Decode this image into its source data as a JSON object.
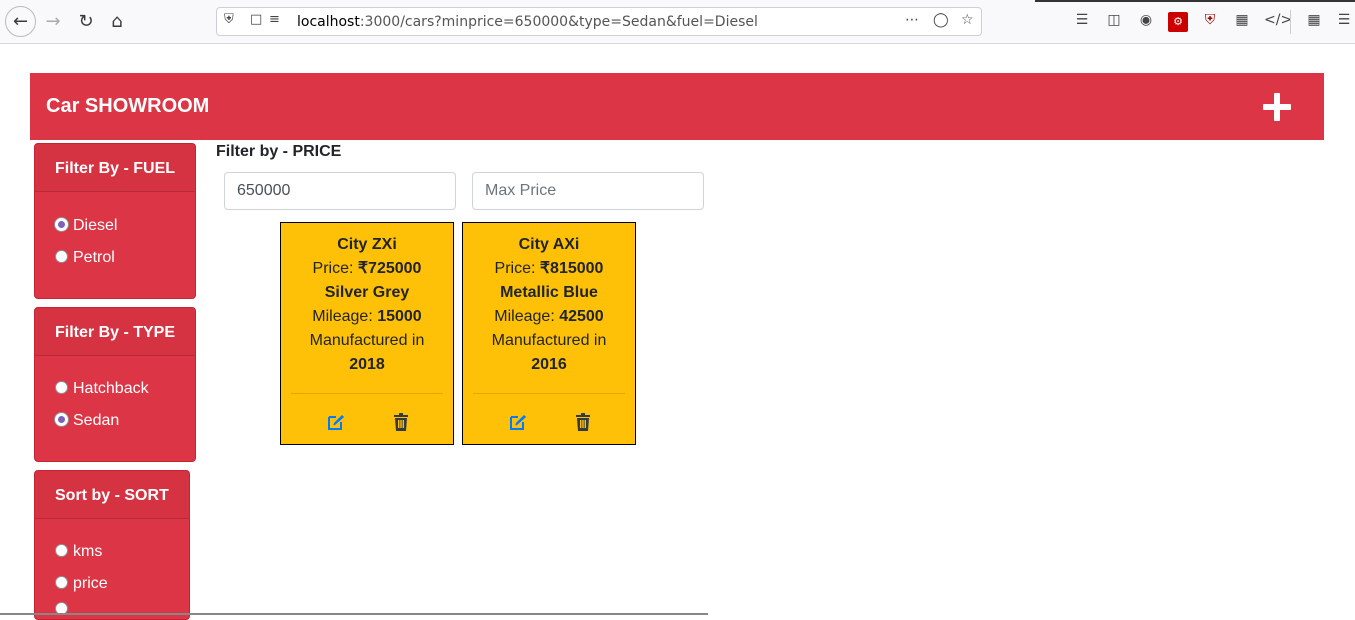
{
  "browser": {
    "url_host": "localhost",
    "url_rest": ":3000/cars?minprice=650000&type=Sedan&fuel=Diesel"
  },
  "app": {
    "title": "Car SHOWROOM",
    "add_icon": "plus-icon",
    "accent_color": "#dc3545",
    "card_color": "#ffc107"
  },
  "filters": {
    "fuel": {
      "title": "Filter By - FUEL",
      "options": [
        {
          "label": "Diesel",
          "checked": true
        },
        {
          "label": "Petrol",
          "checked": false
        }
      ]
    },
    "type": {
      "title": "Filter By - TYPE",
      "options": [
        {
          "label": "Hatchback",
          "checked": false
        },
        {
          "label": "Sedan",
          "checked": true
        }
      ]
    },
    "sort": {
      "title": "Sort by - SORT",
      "options": [
        {
          "label": "kms",
          "checked": false
        },
        {
          "label": "price",
          "checked": false
        }
      ]
    }
  },
  "price": {
    "label": "Filter by - PRICE",
    "min_value": "650000",
    "max_placeholder": "Max Price"
  },
  "cars": [
    {
      "name": "City ZXi",
      "price_label": "Price: ",
      "price": "₹725000",
      "color": "Silver Grey",
      "mileage_label": "Mileage: ",
      "mileage": "15000",
      "manufactured_label": "Manufactured in",
      "year": "2018"
    },
    {
      "name": "City AXi",
      "price_label": "Price: ",
      "price": "₹815000",
      "color": "Metallic Blue",
      "mileage_label": "Mileage: ",
      "mileage": "42500",
      "manufactured_label": "Manufactured in",
      "year": "2016"
    }
  ]
}
